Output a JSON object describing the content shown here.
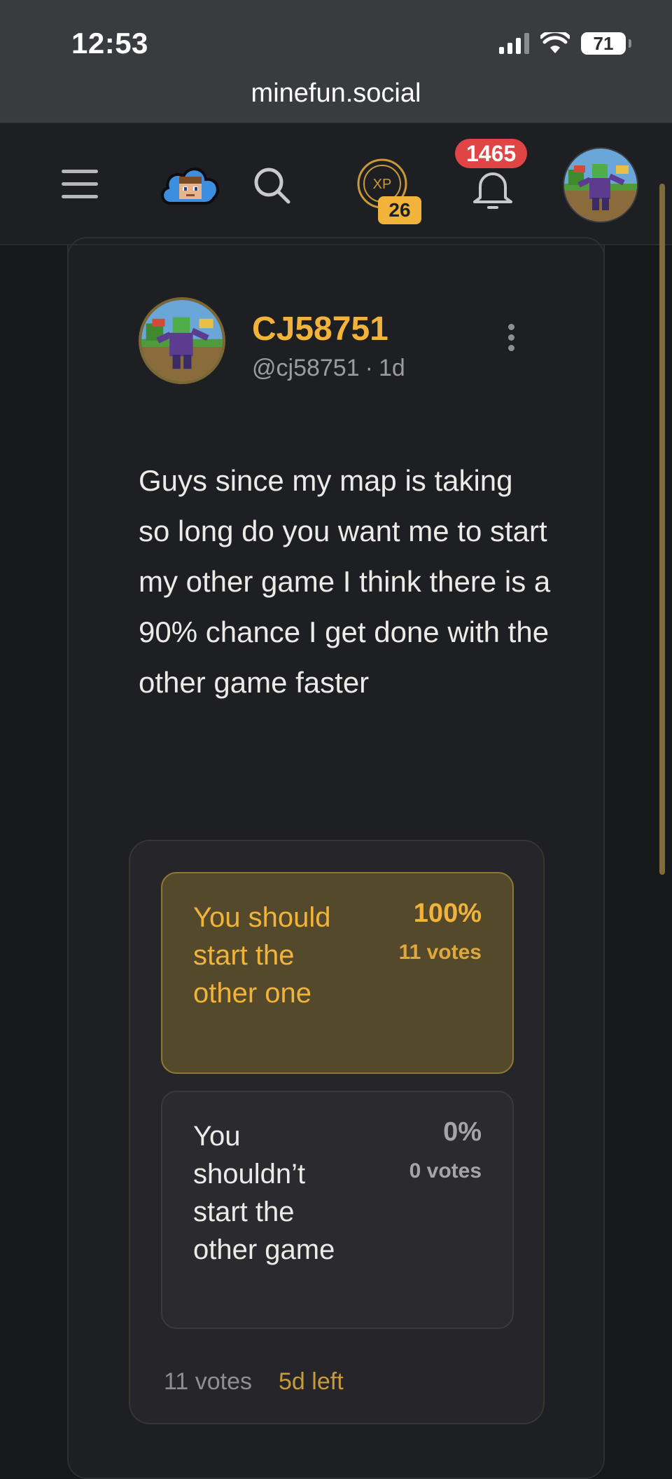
{
  "status_bar": {
    "time": "12:53",
    "battery": "71"
  },
  "browser": {
    "url": "minefun.social"
  },
  "header": {
    "xp_level": "26",
    "notification_count": "1465",
    "xp_icon_text": "XP"
  },
  "post": {
    "author_name": "CJ58751",
    "author_handle": "@cj58751",
    "separator": "·",
    "age": "1d",
    "text": "Guys since my map is taking so long do you want me to start my other game I think there is a 90% chance I get done with the other game faster"
  },
  "poll": {
    "options": [
      {
        "label": "You should start the other one",
        "percent": "100%",
        "votes": "11 votes",
        "share": 1.0
      },
      {
        "label": "You shouldn’t start the other game",
        "percent": "0%",
        "votes": "0 votes",
        "share": 0.0
      }
    ],
    "total_votes": "11 votes",
    "time_left": "5d left"
  },
  "colors": {
    "accent": "#f2b33a",
    "notification": "#e04444",
    "background": "#17181c"
  }
}
